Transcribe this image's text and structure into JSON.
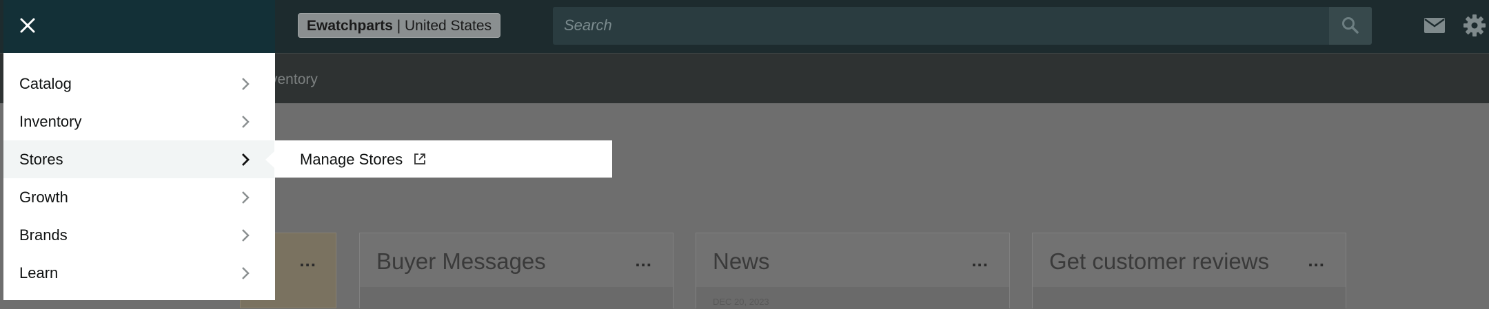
{
  "header": {
    "store_name": "Ewatchparts",
    "store_separator": " | ",
    "store_region": "United States",
    "search_placeholder": "Search",
    "icons": [
      "search-icon",
      "mail-icon",
      "gear-icon"
    ]
  },
  "subnav": {
    "visible_text": "ventory"
  },
  "drawer": {
    "close_icon": "close-icon",
    "items": [
      {
        "label": "Catalog"
      },
      {
        "label": "Inventory"
      },
      {
        "label": "Stores",
        "active": true
      },
      {
        "label": "Growth"
      },
      {
        "label": "Brands"
      },
      {
        "label": "Learn"
      }
    ],
    "flyout": {
      "label": "Manage Stores",
      "icon": "external-link-icon"
    }
  },
  "cards": [
    {
      "title": "",
      "menu": "..."
    },
    {
      "title": "Buyer Messages",
      "menu": "..."
    },
    {
      "title": "News",
      "menu": "...",
      "date": "DEC 20, 2023"
    },
    {
      "title": "Get customer reviews",
      "menu": "..."
    }
  ],
  "colors": {
    "drawer_header": "#133037",
    "topbar": "#1d2b2e",
    "overlay": "#6e6e6e",
    "active_item": "#f2f5f5"
  }
}
